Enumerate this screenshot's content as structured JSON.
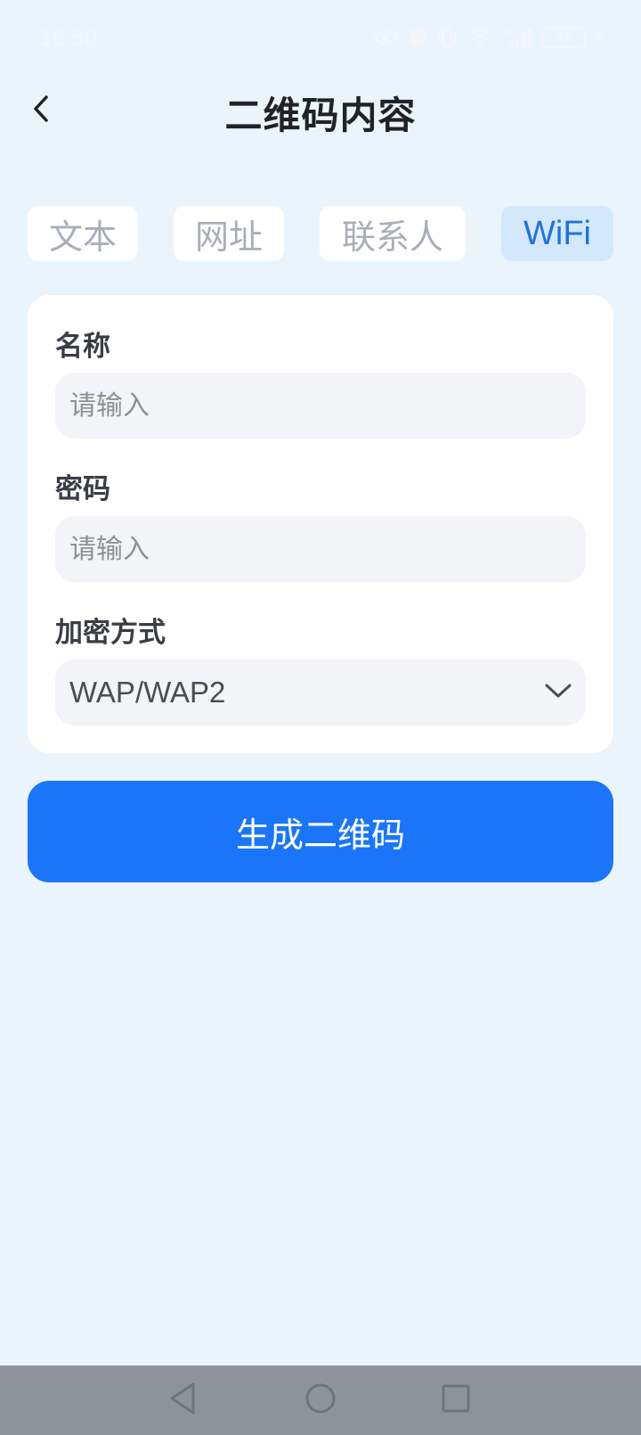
{
  "status_bar": {
    "time": "16:50",
    "battery": "47",
    "icons": [
      "eye-icon",
      "shield-icon",
      "vibrate-icon",
      "wifi-icon",
      "signal-5g-icon",
      "battery-icon",
      "charging-icon"
    ]
  },
  "header": {
    "title": "二维码内容",
    "back_icon": "chevron-left-icon"
  },
  "tabs": [
    {
      "label": "文本",
      "active": false
    },
    {
      "label": "网址",
      "active": false
    },
    {
      "label": "联系人",
      "active": false
    },
    {
      "label": "WiFi",
      "active": true
    }
  ],
  "form": {
    "name": {
      "label": "名称",
      "placeholder": "请输入",
      "value": ""
    },
    "password": {
      "label": "密码",
      "placeholder": "请输入",
      "value": ""
    },
    "encryption": {
      "label": "加密方式",
      "value": "WAP/WAP2"
    }
  },
  "generate_button": {
    "label": "生成二维码"
  },
  "colors": {
    "background": "#eaf4fd",
    "accent": "#1a75fb",
    "active_tab_bg": "#d4e8fc",
    "active_tab_text": "#1f72e0",
    "nav_bar": "#8e9399"
  }
}
